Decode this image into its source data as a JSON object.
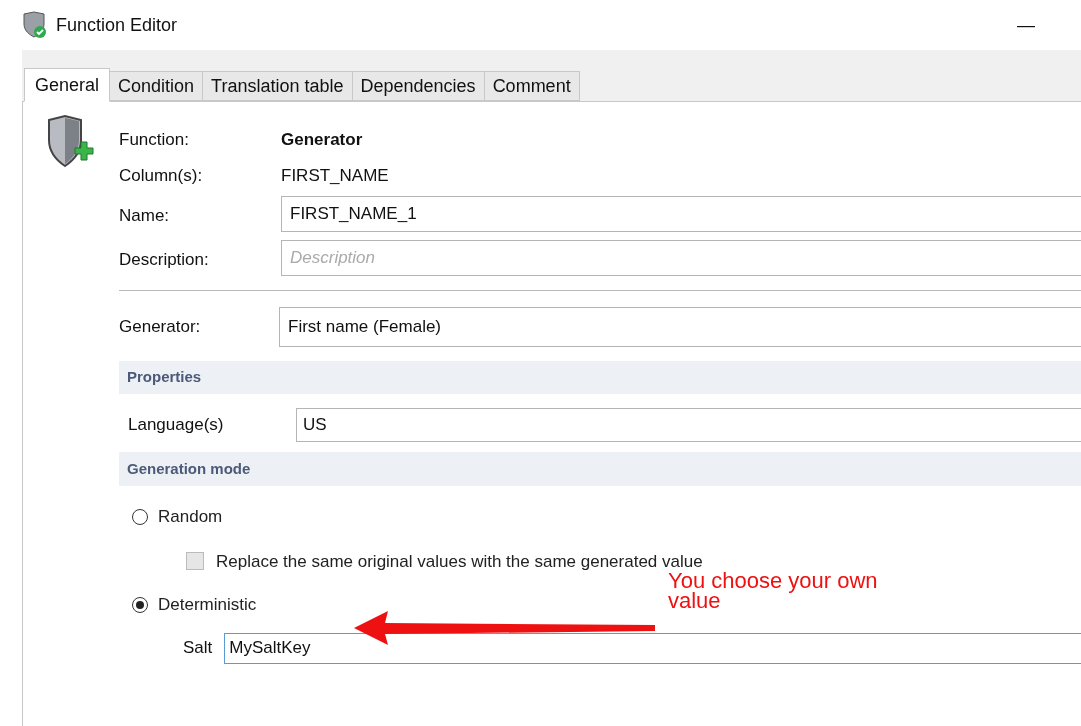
{
  "window": {
    "title": "Function Editor",
    "minimize": "—"
  },
  "tabs": [
    {
      "label": "General",
      "selected": true
    },
    {
      "label": "Condition",
      "selected": false
    },
    {
      "label": "Translation table",
      "selected": false
    },
    {
      "label": "Dependencies",
      "selected": false
    },
    {
      "label": "Comment",
      "selected": false
    }
  ],
  "info": [
    {
      "label": "Function:",
      "value": "Generator",
      "bold": true
    },
    {
      "label": "Column(s):",
      "value": "FIRST_NAME",
      "bold": false
    }
  ],
  "fields": [
    {
      "label": "Name:",
      "value": "FIRST_NAME_1"
    },
    {
      "label": "Description:",
      "placeholder": "Description"
    }
  ],
  "generator": {
    "label": "Generator:",
    "value": "First name (Female)"
  },
  "properties": {
    "header": "Properties",
    "label": "Language(s)",
    "value": "US"
  },
  "generation_mode": {
    "header": "Generation mode",
    "options": [
      {
        "label": "Random",
        "selected": false
      },
      {
        "label": "Deterministic",
        "selected": true
      }
    ],
    "replace_checkbox": {
      "label": "Replace the same original values with the same generated value",
      "checked": false,
      "disabled": true
    },
    "salt": {
      "label": "Salt",
      "value": "MySaltKey",
      "focused": true
    }
  },
  "annotation": {
    "text": "You choose your own value"
  }
}
